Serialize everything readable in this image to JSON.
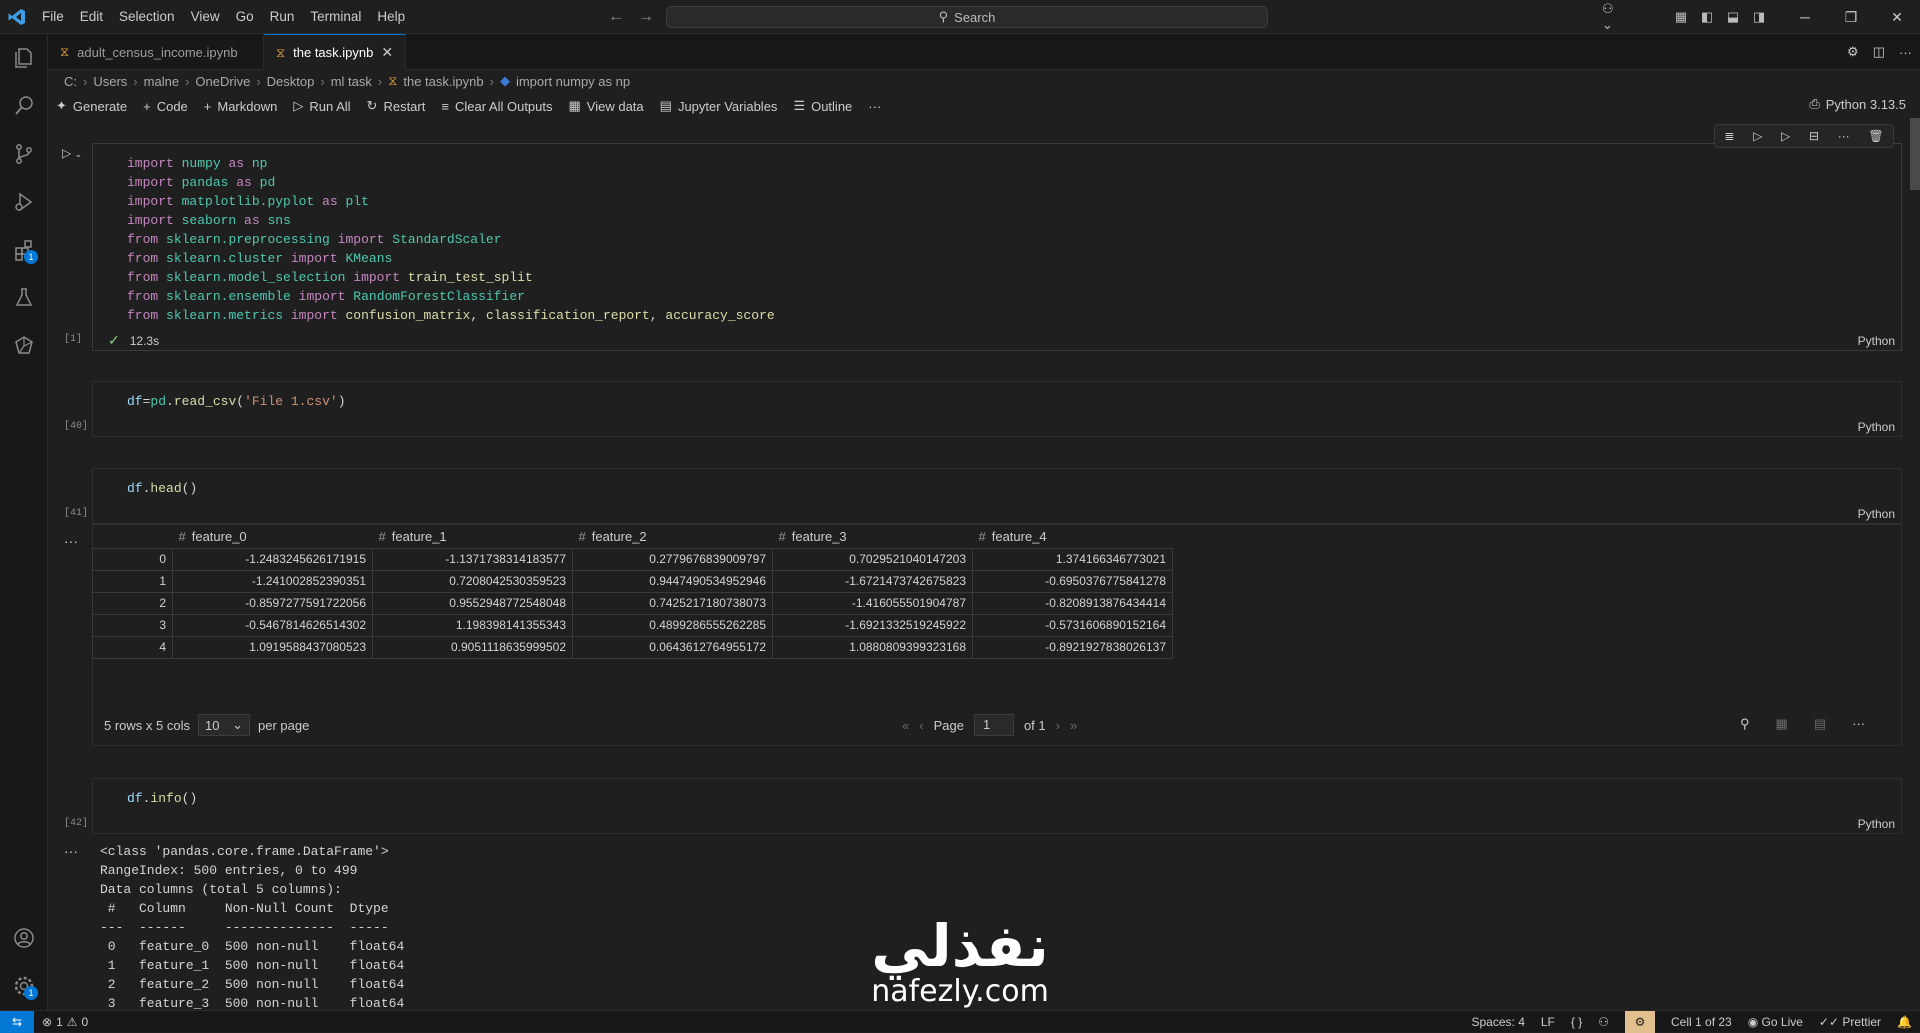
{
  "menu": [
    "File",
    "Edit",
    "Selection",
    "View",
    "Go",
    "Run",
    "Terminal",
    "Help"
  ],
  "search": {
    "label": "Search"
  },
  "tabs": [
    {
      "label": "adult_census_income.ipynb"
    },
    {
      "label": "the task.ipynb"
    }
  ],
  "breadcrumb": [
    "C:",
    "Users",
    "malne",
    "OneDrive",
    "Desktop",
    "ml task",
    "the task.ipynb",
    "import numpy as np"
  ],
  "toolbar": {
    "generate": "Generate",
    "code": "Code",
    "markdown": "Markdown",
    "run_all": "Run All",
    "restart": "Restart",
    "clear": "Clear All Outputs",
    "view_data": "View data",
    "variables": "Jupyter Variables",
    "outline": "Outline"
  },
  "kernel": "Python 3.13.5",
  "cells": {
    "c1": {
      "exec": "[1]",
      "time": "12.3s",
      "lang": "Python"
    },
    "c2": {
      "exec": "[40]",
      "lang": "Python"
    },
    "c3": {
      "exec": "[41]",
      "lang": "Python"
    },
    "c4": {
      "exec": "[42]",
      "lang": "Python"
    }
  },
  "df_table": {
    "columns": [
      "feature_0",
      "feature_1",
      "feature_2",
      "feature_3",
      "feature_4"
    ],
    "rows": [
      [
        "0",
        "-1.2483245626171915",
        "-1.1371738314183577",
        "0.2779676839009797",
        "0.7029521040147203",
        "1.374166346773021"
      ],
      [
        "1",
        "-1.241002852390351",
        "0.7208042530359523",
        "0.9447490534952946",
        "-1.6721473742675823",
        "-0.6950376775841278"
      ],
      [
        "2",
        "-0.8597277591722056",
        "0.9552948772548048",
        "0.7425217180738073",
        "-1.416055501904787",
        "-0.8208913876434414"
      ],
      [
        "3",
        "-0.5467814626514302",
        "1.198398141355343",
        "0.4899286555262285",
        "-1.6921332519245922",
        "-0.5731606890152164"
      ],
      [
        "4",
        "1.0919588437080523",
        "0.9051118635999502",
        "0.0643612764955172",
        "1.0880809399323168",
        "-0.8921927838026137"
      ]
    ],
    "summary": "5 rows x 5 cols",
    "per_page_value": "10",
    "per_page_label": "per page",
    "page_label": "Page",
    "page_value": "1",
    "of_label": "of 1"
  },
  "info_output": "<class 'pandas.core.frame.DataFrame'>\nRangeIndex: 500 entries, 0 to 499\nData columns (total 5 columns):\n #   Column     Non-Null Count  Dtype  \n---  ------     --------------  -----  \n 0   feature_0  500 non-null    float64\n 1   feature_1  500 non-null    float64\n 2   feature_2  500 non-null    float64\n 3   feature_3  500 non-null    float64",
  "watermark": {
    "arabic": "نفذلي",
    "latin": "nafezly.com"
  },
  "statusbar": {
    "errors": "1",
    "warnings": "0",
    "spaces": "Spaces: 4",
    "eol": "LF",
    "braces": "{ }",
    "cell": "Cell 1 of 23",
    "golive": "Go Live",
    "prettier": "Prettier"
  },
  "colors": {
    "accent": "#0078d4",
    "background": "#1f1f1f"
  }
}
